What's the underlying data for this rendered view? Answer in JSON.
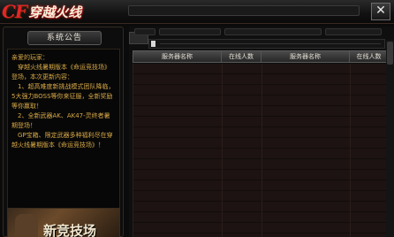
{
  "app": {
    "logo_prefix": "CF",
    "logo_title": "穿越火线",
    "close_label": "✕"
  },
  "notice": {
    "tab_label": "系统公告",
    "lines": [
      "亲爱的玩家：",
      "　穿越火线暑期版本《命运竞技场》登场，本次更新内容：",
      "　1、超高难度新挑战模式团队降临，5大强力BOSS等你来征服，全新奖励等你赢取！",
      "　2、全新武器AK、AK47-灵终者暑期登场！",
      "　GP宝箱、限定武器多种福利尽在穿越火线暑期版本《命运竞技场》！"
    ],
    "promo_text": "新竞技场"
  },
  "server_list": {
    "columns": [
      "服务器名称",
      "在线人数",
      "服务器名称",
      "在线人数"
    ]
  }
}
